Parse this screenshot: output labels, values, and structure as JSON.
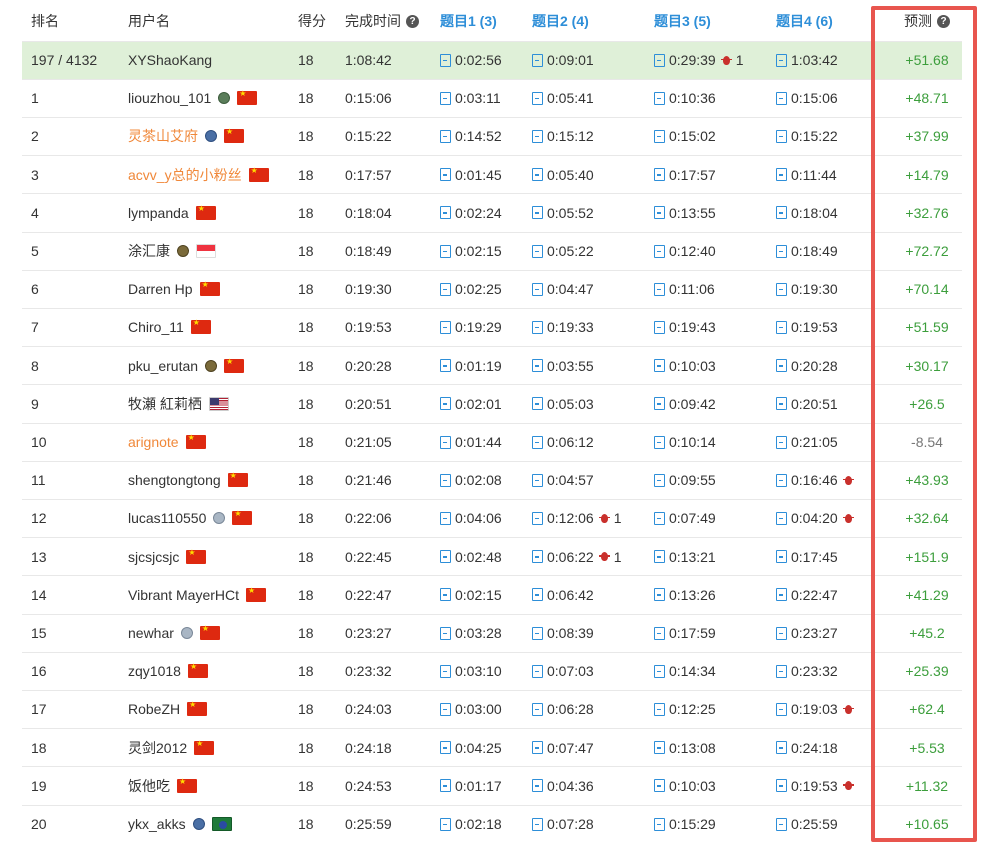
{
  "header": {
    "rank": "排名",
    "username": "用户名",
    "score": "得分",
    "finish_time": "完成时间",
    "q1": "题目1 (3)",
    "q2": "题目2 (4)",
    "q3": "题目3 (5)",
    "q4": "题目4 (6)",
    "prediction": "预测"
  },
  "help_icon": "?",
  "rows": [
    {
      "rank": "197 / 4132",
      "user": "XYShaoKang",
      "color": "me",
      "score": "18",
      "time": "1:08:42",
      "q1": "0:02:56",
      "q2": "0:09:01",
      "q3": "0:29:39",
      "q3_bugs": "1",
      "q4": "1:03:42",
      "pred": "+51.68"
    },
    {
      "rank": "1",
      "user": "liouzhou_101",
      "badge": "ac",
      "flag": "cn",
      "score": "18",
      "time": "0:15:06",
      "q1": "0:03:11",
      "q2": "0:05:41",
      "q3": "0:10:36",
      "q4": "0:15:06",
      "pred": "+48.71"
    },
    {
      "rank": "2",
      "user": "灵茶山艾府",
      "color": "orange",
      "badge": "blue",
      "flag": "cn",
      "score": "18",
      "time": "0:15:22",
      "q1": "0:14:52",
      "q2": "0:15:12",
      "q3": "0:15:02",
      "q4": "0:15:22",
      "pred": "+37.99"
    },
    {
      "rank": "3",
      "user": "acvv_y总的小粉丝",
      "color": "orange",
      "flag": "cn",
      "score": "18",
      "time": "0:17:57",
      "q1": "0:01:45",
      "q2": "0:05:40",
      "q3": "0:17:57",
      "q4": "0:11:44",
      "pred": "+14.79"
    },
    {
      "rank": "4",
      "user": "lympanda",
      "flag": "cn",
      "score": "18",
      "time": "0:18:04",
      "q1": "0:02:24",
      "q2": "0:05:52",
      "q3": "0:13:55",
      "q4": "0:18:04",
      "pred": "+32.76"
    },
    {
      "rank": "5",
      "user": "涂汇康",
      "badge": "gold",
      "flag": "sg",
      "score": "18",
      "time": "0:18:49",
      "q1": "0:02:15",
      "q2": "0:05:22",
      "q3": "0:12:40",
      "q4": "0:18:49",
      "pred": "+72.72"
    },
    {
      "rank": "6",
      "user": "Darren Hp",
      "flag": "cn",
      "score": "18",
      "time": "0:19:30",
      "q1": "0:02:25",
      "q2": "0:04:47",
      "q3": "0:11:06",
      "q4": "0:19:30",
      "pred": "+70.14"
    },
    {
      "rank": "7",
      "user": "Chiro_11",
      "flag": "cn",
      "score": "18",
      "time": "0:19:53",
      "q1": "0:19:29",
      "q2": "0:19:33",
      "q3": "0:19:43",
      "q4": "0:19:53",
      "pred": "+51.59"
    },
    {
      "rank": "8",
      "user": "pku_erutan",
      "badge": "gold",
      "flag": "cn",
      "score": "18",
      "time": "0:20:28",
      "q1": "0:01:19",
      "q2": "0:03:55",
      "q3": "0:10:03",
      "q4": "0:20:28",
      "pred": "+30.17"
    },
    {
      "rank": "9",
      "user": "牧瀬 紅莉栖",
      "flag": "us",
      "score": "18",
      "time": "0:20:51",
      "q1": "0:02:01",
      "q2": "0:05:03",
      "q3": "0:09:42",
      "q4": "0:20:51",
      "pred": "+26.5"
    },
    {
      "rank": "10",
      "user": "arignote",
      "color": "orange",
      "flag": "cn",
      "score": "18",
      "time": "0:21:05",
      "q1": "0:01:44",
      "q2": "0:06:12",
      "q3": "0:10:14",
      "q4": "0:21:05",
      "pred": "-8.54"
    },
    {
      "rank": "11",
      "user": "shengtongtong",
      "flag": "cn",
      "score": "18",
      "time": "0:21:46",
      "q1": "0:02:08",
      "q2": "0:04:57",
      "q3": "0:09:55",
      "q4": "0:16:46",
      "q4_bug": true,
      "pred": "+43.93"
    },
    {
      "rank": "12",
      "user": "lucas110550",
      "badge": "silver",
      "flag": "cn",
      "score": "18",
      "time": "0:22:06",
      "q1": "0:04:06",
      "q2": "0:12:06",
      "q2_bugs": "1",
      "q3": "0:07:49",
      "q4": "0:04:20",
      "q4_bug": true,
      "pred": "+32.64"
    },
    {
      "rank": "13",
      "user": "sjcsjcsjc",
      "flag": "cn",
      "score": "18",
      "time": "0:22:45",
      "q1": "0:02:48",
      "q2": "0:06:22",
      "q2_bugs": "1",
      "q3": "0:13:21",
      "q4": "0:17:45",
      "pred": "+151.9"
    },
    {
      "rank": "14",
      "user": "Vibrant MayerHCt",
      "flag": "cn",
      "score": "18",
      "time": "0:22:47",
      "q1": "0:02:15",
      "q2": "0:06:42",
      "q3": "0:13:26",
      "q4": "0:22:47",
      "pred": "+41.29"
    },
    {
      "rank": "15",
      "user": "newhar",
      "badge": "silver",
      "flag": "cn",
      "score": "18",
      "time": "0:23:27",
      "q1": "0:03:28",
      "q2": "0:08:39",
      "q3": "0:17:59",
      "q4": "0:23:27",
      "pred": "+45.2"
    },
    {
      "rank": "16",
      "user": "zqy1018",
      "flag": "cn",
      "score": "18",
      "time": "0:23:32",
      "q1": "0:03:10",
      "q2": "0:07:03",
      "q3": "0:14:34",
      "q4": "0:23:32",
      "pred": "+25.39"
    },
    {
      "rank": "17",
      "user": "RobeZH",
      "flag": "cn",
      "score": "18",
      "time": "0:24:03",
      "q1": "0:03:00",
      "q2": "0:06:28",
      "q3": "0:12:25",
      "q4": "0:19:03",
      "q4_bug": true,
      "pred": "+62.4"
    },
    {
      "rank": "18",
      "user": "灵剑2012",
      "flag": "cn",
      "score": "18",
      "time": "0:24:18",
      "q1": "0:04:25",
      "q2": "0:07:47",
      "q3": "0:13:08",
      "q4": "0:24:18",
      "pred": "+5.53"
    },
    {
      "rank": "19",
      "user": "饭他吃",
      "flag": "cn",
      "score": "18",
      "time": "0:24:53",
      "q1": "0:01:17",
      "q2": "0:04:36",
      "q3": "0:10:03",
      "q4": "0:19:53",
      "q4_bug": true,
      "pred": "+11.32"
    },
    {
      "rank": "20",
      "user": "ykx_akks",
      "badge": "blue",
      "flag": "br",
      "score": "18",
      "time": "0:25:59",
      "q1": "0:02:18",
      "q2": "0:07:28",
      "q3": "0:15:29",
      "q4": "0:25:59",
      "pred": "+10.65"
    }
  ],
  "colors": {
    "link_blue": "#2d8ed8",
    "highlight_row": "#dff0d8",
    "positive": "#3c9e3c",
    "negative": "#777777",
    "orange_user": "#f0883a",
    "annotation_red": "#e8554e"
  }
}
